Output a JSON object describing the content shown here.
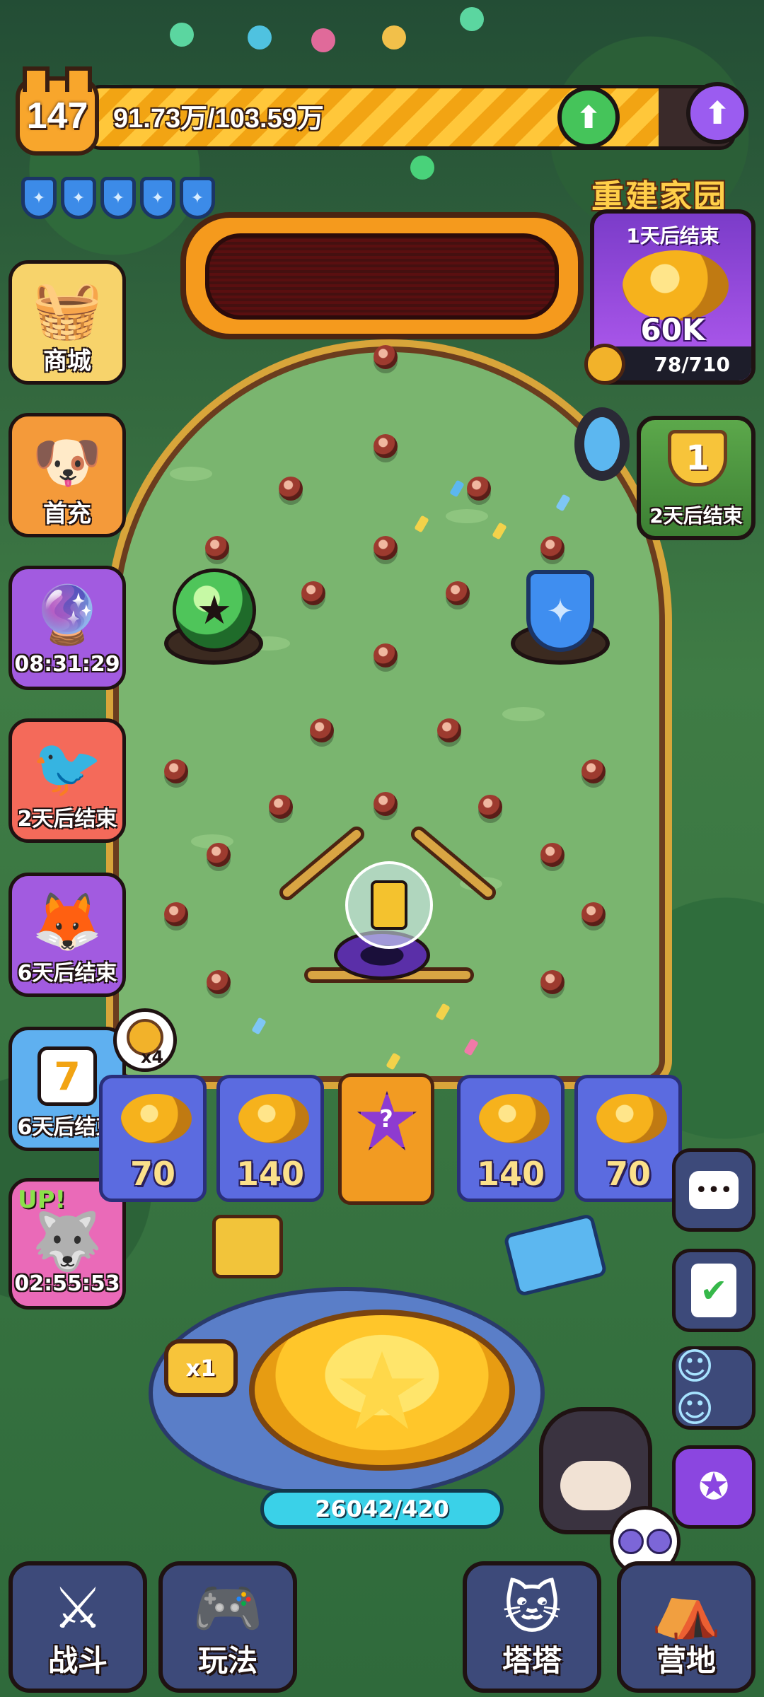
{
  "player": {
    "level": "147",
    "xp_text": "91.73万/103.59万",
    "xp_fraction": 0.886
  },
  "shields": {
    "count": 5
  },
  "event": {
    "title": "重建家园",
    "timer": "1天后结束",
    "amount": "60K",
    "progress_text": "78/710",
    "progress_fraction": 0.11
  },
  "trophy": {
    "rank": "1",
    "timer": "2天后结束"
  },
  "left_buttons": [
    {
      "label": "商城",
      "icon": "basket-icon"
    },
    {
      "label": "首充",
      "icon": "dog-mascot-icon"
    },
    {
      "label": "08:31:29",
      "icon": "orb-basket-icon"
    },
    {
      "label": "2天后结束",
      "icon": "bird-icon"
    },
    {
      "label": "6天后结束",
      "icon": "gold-fox-icon"
    },
    {
      "label": "6天后结束",
      "icon": "calendar-icon"
    },
    {
      "label": "02:55:53",
      "icon": "husky-icon"
    }
  ],
  "calendar_day": "7",
  "key_bonus": "x4",
  "up_badge": "UP!",
  "prize_slots": [
    "70",
    "140",
    "140",
    "70"
  ],
  "launcher": {
    "multiplier": "x1",
    "ball_count": "26042/420"
  },
  "bottom_nav": [
    {
      "label": "战斗",
      "icon": "swords-icon"
    },
    {
      "label": "玩法",
      "icon": "gamepad-icon"
    },
    {
      "label": "塔塔",
      "icon": "robot-cat-icon"
    },
    {
      "label": "营地",
      "icon": "tent-icon"
    }
  ]
}
